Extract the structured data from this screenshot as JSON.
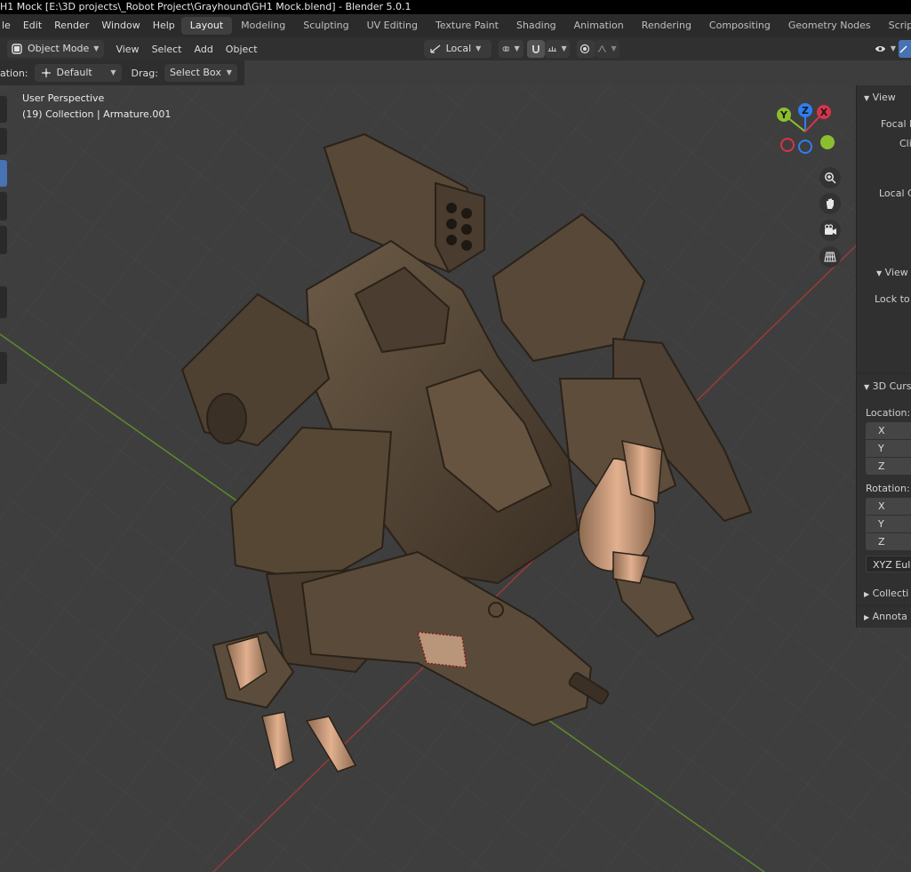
{
  "window": {
    "title": "H1 Mock [E:\\3D projects\\_Robot Project\\Grayhound\\GH1 Mock.blend] - Blender 5.0.1"
  },
  "menu": [
    "le",
    "Edit",
    "Render",
    "Window",
    "Help"
  ],
  "workspaces": [
    "Layout",
    "Modeling",
    "Sculpting",
    "UV Editing",
    "Texture Paint",
    "Shading",
    "Animation",
    "Rendering",
    "Compositing",
    "Geometry Nodes",
    "Scrip"
  ],
  "active_workspace": "Layout",
  "header": {
    "mode": "Object Mode",
    "menus": [
      "View",
      "Select",
      "Add",
      "Object"
    ],
    "transform_orientation": "Local"
  },
  "tool_settings": {
    "orientation_label": "ation:",
    "orientation_value": "Default",
    "drag_label": "Drag:",
    "drag_value": "Select Box"
  },
  "viewport": {
    "view_name": "User Perspective",
    "collection_info": "(19) Collection | Armature.001",
    "axes": {
      "y": "Y",
      "z": "Z",
      "x": "X"
    },
    "colors": {
      "x": "#d7334b",
      "y": "#8cbf2e",
      "z": "#2f7ef5",
      "grid_x": "#9b3a3a",
      "grid_y": "#5e8a2c"
    }
  },
  "sidebar": {
    "view_header": "View",
    "focal": "Focal L",
    "clip": "Cli",
    "local_camera": "Local C",
    "view_lock_header": "View",
    "lock_to": "Lock to",
    "cursor_header": "3D Curs",
    "location_label": "Location:",
    "rotation_label": "Rotation:",
    "axes": [
      "X",
      "Y",
      "Z"
    ],
    "rotation_mode": "XYZ Eule",
    "collections": "Collecti",
    "annotations": "Annota"
  }
}
